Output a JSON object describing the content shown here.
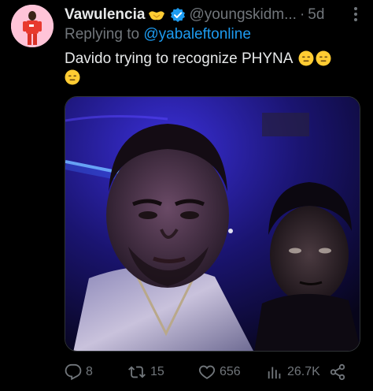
{
  "tweet": {
    "display_name": "Vawulencia",
    "handle": "@youngskidm...",
    "separator": "·",
    "time": "5d",
    "replying_prefix": "Replying to ",
    "replying_to": "@yabaleftonline",
    "text": "Davido trying to recognize PHYNA",
    "text_emojis": [
      "expressionless-face",
      "expressionless-face",
      "expressionless-face"
    ]
  },
  "actions": {
    "replies": "8",
    "retweets": "15",
    "likes": "656",
    "views": "26.7K"
  },
  "colors": {
    "background": "#000000",
    "text": "#e7e9ea",
    "muted": "#71767b",
    "link": "#1d9bf0",
    "verified": "#1d9bf0",
    "emoji": "#ffcc33"
  },
  "icons": [
    "handshake-emoji",
    "verified-badge-icon",
    "more-icon",
    "reply-icon",
    "retweet-icon",
    "like-icon",
    "views-icon",
    "share-icon"
  ]
}
